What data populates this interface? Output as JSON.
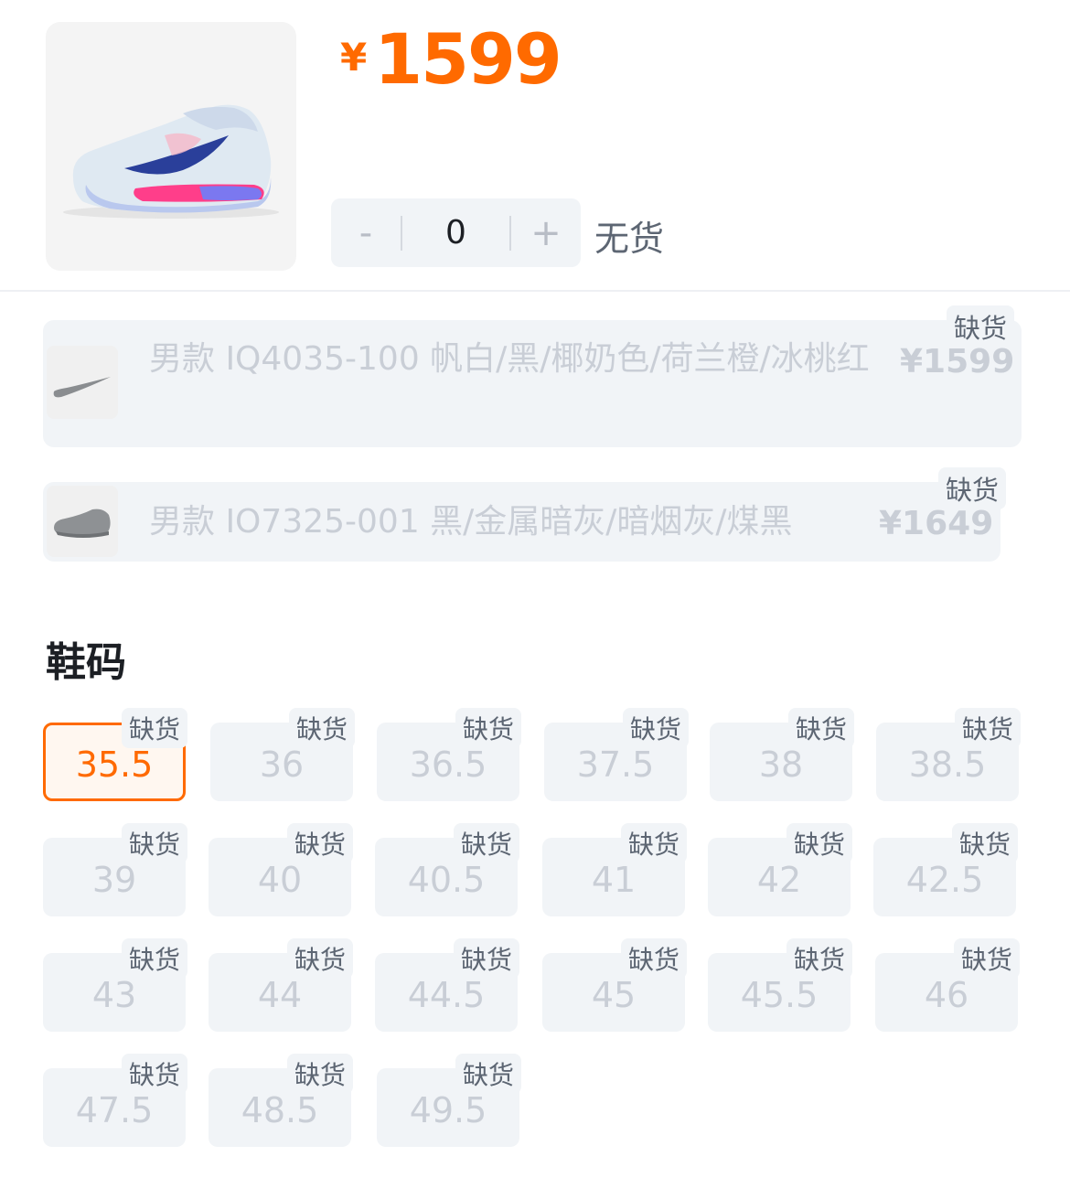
{
  "product": {
    "price_currency": "¥",
    "price_value": "1599",
    "quantity": "0",
    "minus_label": "-",
    "plus_label": "+",
    "stock_status": "无货"
  },
  "variants": [
    {
      "name": "男款 IQ4035-100 帆白/黑/椰奶色/荷兰橙/冰桃红",
      "price": "¥1599",
      "tag": "缺货"
    },
    {
      "name": "男款 IO7325-001 黑/金属暗灰/暗烟灰/煤黑",
      "price": "¥1649",
      "tag": "缺货"
    }
  ],
  "size_section": {
    "title": "鞋码",
    "selected": "35.5",
    "sizes": [
      {
        "label": "35.5",
        "tag": "缺货"
      },
      {
        "label": "36",
        "tag": "缺货"
      },
      {
        "label": "36.5",
        "tag": "缺货"
      },
      {
        "label": "37.5",
        "tag": "缺货"
      },
      {
        "label": "38",
        "tag": "缺货"
      },
      {
        "label": "38.5",
        "tag": "缺货"
      },
      {
        "label": "39",
        "tag": "缺货"
      },
      {
        "label": "40",
        "tag": "缺货"
      },
      {
        "label": "40.5",
        "tag": "缺货"
      },
      {
        "label": "41",
        "tag": "缺货"
      },
      {
        "label": "42",
        "tag": "缺货"
      },
      {
        "label": "42.5",
        "tag": "缺货"
      },
      {
        "label": "43",
        "tag": "缺货"
      },
      {
        "label": "44",
        "tag": "缺货"
      },
      {
        "label": "44.5",
        "tag": "缺货"
      },
      {
        "label": "45",
        "tag": "缺货"
      },
      {
        "label": "45.5",
        "tag": "缺货"
      },
      {
        "label": "46",
        "tag": "缺货"
      },
      {
        "label": "47.5",
        "tag": "缺货"
      },
      {
        "label": "48.5",
        "tag": "缺货"
      },
      {
        "label": "49.5",
        "tag": "缺货"
      }
    ]
  },
  "colors": {
    "accent": "#ff6a00",
    "chip_bg": "#f1f4f7",
    "disabled_text": "#c9ced6"
  }
}
